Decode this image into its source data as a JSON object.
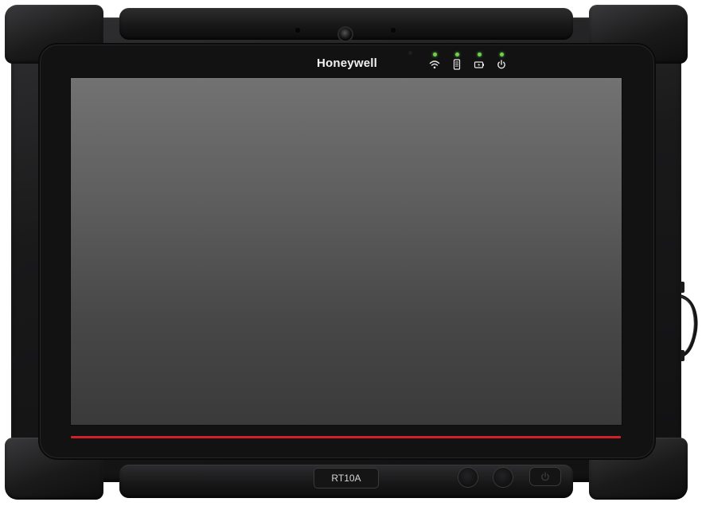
{
  "device": {
    "brand": "Honeywell",
    "model": "RT10A"
  },
  "status_indicators": [
    {
      "name": "wifi",
      "icon": "wifi-icon",
      "led_color": "#6fd04a"
    },
    {
      "name": "storage",
      "icon": "storage-icon",
      "led_color": "#6fd04a"
    },
    {
      "name": "battery",
      "icon": "battery-charging-icon",
      "led_color": "#6fd04a"
    },
    {
      "name": "power",
      "icon": "power-icon",
      "led_color": "#6fd04a"
    }
  ],
  "hardware_buttons": [
    {
      "name": "button-left",
      "icon": "round-button"
    },
    {
      "name": "button-right",
      "icon": "round-button"
    },
    {
      "name": "power-button",
      "icon": "power-icon"
    }
  ],
  "colors": {
    "housing": "#1a1a1b",
    "screen": "#5e5e5e",
    "accent": "#d0202a",
    "led": "#6fd04a",
    "brand_text": "#f2f2f2"
  }
}
